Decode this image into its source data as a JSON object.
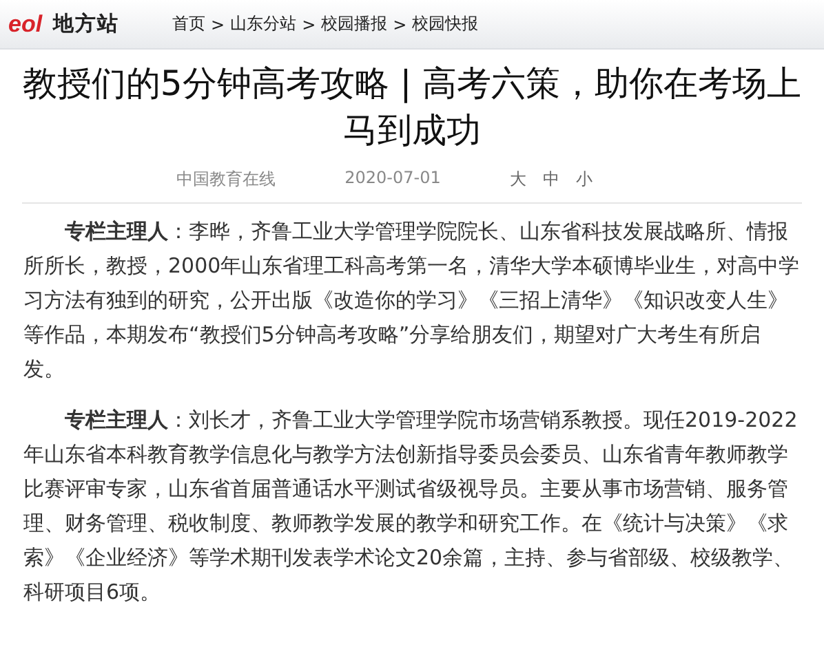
{
  "header": {
    "logo": "eol",
    "site_name": "地方站",
    "breadcrumb": [
      {
        "label": "首页"
      },
      {
        "label": "山东分站"
      },
      {
        "label": "校园播报"
      },
      {
        "label": "校园快报"
      }
    ],
    "separator": ">"
  },
  "article": {
    "title": "教授们的5分钟高考攻略 | 高考六策，助你在考场上马到成功",
    "source": "中国教育在线",
    "date": "2020-07-01",
    "font_sizes": [
      {
        "label": "大"
      },
      {
        "label": "中"
      },
      {
        "label": "小"
      }
    ],
    "paragraphs": [
      "**专栏主理人**：李晔，齐鲁工业大学管理学院院长、山东省科技发展战略所、情报所所长，教授，2000年山东省理工科高考第一名，清华大学本硕博毕业生，对高中学习方法有独到的研究，公开出版《改造你的学习》《三招上清华》《知识改变人生》等作品，本期发布“教授们5分钟高考攻略”分享给朋友们，期望对广大考生有所启发。",
      "**专栏主理人**：刘长才，齐鲁工业大学管理学院市场营销系教授。现任2019-2022年山东省本科教育教学信息化与教学方法创新指导委员会委员、山东省青年教师教学比赛评审专家，山东省首届普通话水平测试省级视导员。主要从事市场营销、服务管理、财务管理、税收制度、教师教学发展的教学和研究工作。在《统计与决策》《求索》《企业经济》等学术期刊发表学术论文20余篇，主持、参与省部级、校级教学、科研项目6项。"
    ]
  }
}
